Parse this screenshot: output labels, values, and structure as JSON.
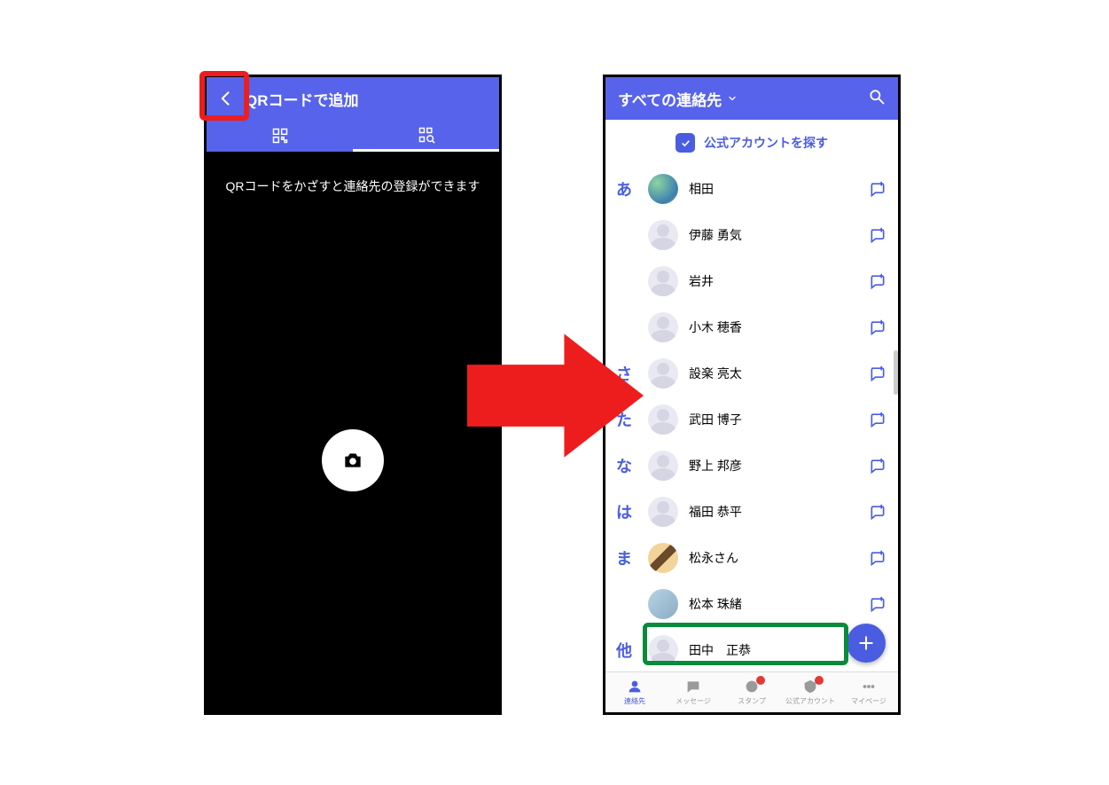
{
  "left": {
    "header_title": "QRコードで追加",
    "instruction": "QRコードをかざすと連絡先の登録ができます"
  },
  "right": {
    "header_title": "すべての連絡先",
    "official_label": "公式アカウントを探す",
    "index": {
      "a": "あ",
      "sa": "さ",
      "ta": "た",
      "na": "な",
      "ha": "は",
      "ma": "ま",
      "other": "他"
    },
    "contacts": {
      "c0": "相田",
      "c1": "伊藤 勇気",
      "c2": "岩井",
      "c3": "小木 穂香",
      "c4": "設楽 亮太",
      "c5": "武田 博子",
      "c6": "野上 邦彦",
      "c7": "福田 恭平",
      "c8": "松永さん",
      "c9": "松本 珠緒",
      "c10": "田中　正恭"
    },
    "nav": {
      "n0": "連絡先",
      "n1": "メッセージ",
      "n2": "スタンプ",
      "n3": "公式アカウント",
      "n4": "マイページ"
    }
  }
}
